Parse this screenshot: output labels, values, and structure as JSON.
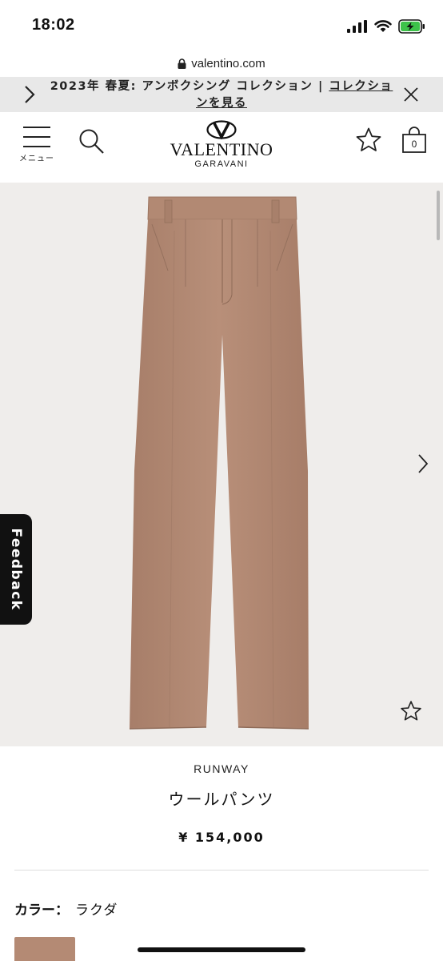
{
  "status_bar": {
    "time": "18:02"
  },
  "browser": {
    "url": "valentino.com"
  },
  "promo_banner": {
    "text": "2023年 春夏: アンボクシング コレクション | ",
    "link_text": "コレクションを見る"
  },
  "header": {
    "menu_label": "メニュー",
    "brand": "VALENTINO",
    "brand_sub": "GARAVANI",
    "bag_count": "0"
  },
  "gallery": {
    "feedback_label": "Feedback",
    "product_color_hex": "#b48a74",
    "background_hex": "#efedeb"
  },
  "product": {
    "collection": "RUNWAY",
    "name": "ウールパンツ",
    "price": "¥ 154,000",
    "color_label": "カラー：",
    "color_value": "ラクダ"
  }
}
